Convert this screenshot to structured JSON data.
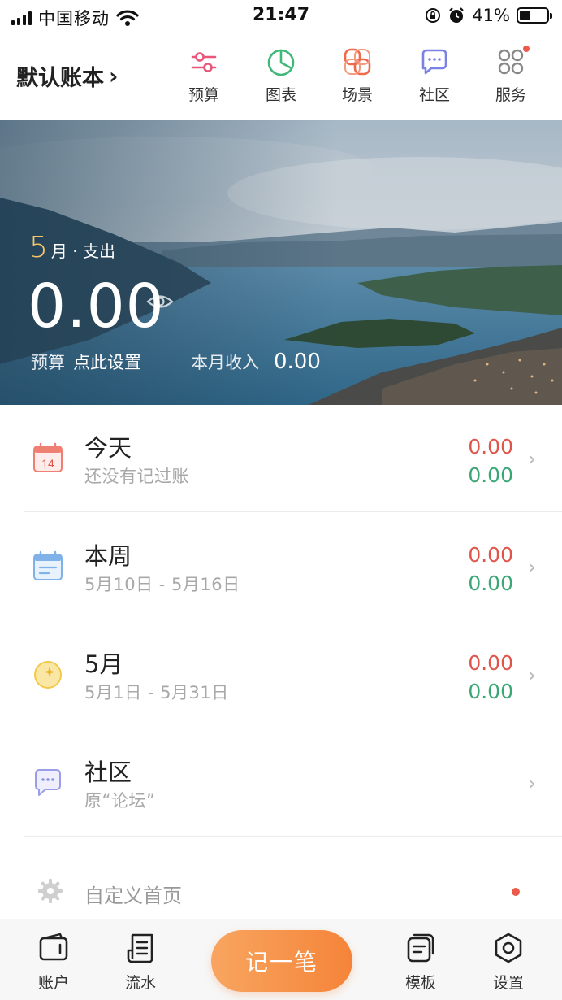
{
  "status_bar": {
    "carrier": "中国移动",
    "time": "21:47",
    "battery_percent": "41%",
    "battery_level": 0.41,
    "icons": [
      "signal-icon",
      "wifi-icon",
      "orientation-lock-icon",
      "alarm-icon",
      "battery-icon"
    ]
  },
  "header": {
    "book_name": "默认账本",
    "nav": [
      {
        "label": "预算",
        "icon": "sliders-icon",
        "color": "#e8577a"
      },
      {
        "label": "图表",
        "icon": "pie-chart-icon",
        "color": "#3fb979"
      },
      {
        "label": "场景",
        "icon": "scene-icon",
        "color": "#f06a4a"
      },
      {
        "label": "社区",
        "icon": "chat-bubble-icon",
        "color": "#7a82e6"
      },
      {
        "label": "服务",
        "icon": "grid-icon",
        "color": "#888888",
        "badge": true
      }
    ]
  },
  "hero": {
    "month_number": "5",
    "month_suffix": "月 · 支出",
    "expense_amount": "0.00",
    "budget_label": "预算",
    "budget_action": "点此设置",
    "income_label": "本月收入",
    "income_amount": "0.00"
  },
  "summary_rows": [
    {
      "title": "今天",
      "subtitle": "还没有记过账",
      "expense": "0.00",
      "income": "0.00",
      "icon": "calendar-day-icon",
      "icon_text": "14"
    },
    {
      "title": "本周",
      "subtitle": "5月10日 - 5月16日",
      "expense": "0.00",
      "income": "0.00",
      "icon": "calendar-week-icon"
    },
    {
      "title": "5月",
      "subtitle": "5月1日 - 5月31日",
      "expense": "0.00",
      "income": "0.00",
      "icon": "moon-icon"
    },
    {
      "title": "社区",
      "subtitle": "原“论坛”",
      "icon": "community-icon"
    }
  ],
  "custom_home": {
    "label": "自定义首页",
    "icon": "gear-icon"
  },
  "colors": {
    "expense": "#e0544a",
    "income": "#3aa774",
    "accent": "#f58439"
  },
  "tab_bar": {
    "account": "账户",
    "flow": "流水",
    "record": "记一笔",
    "template": "模板",
    "settings": "设置"
  }
}
